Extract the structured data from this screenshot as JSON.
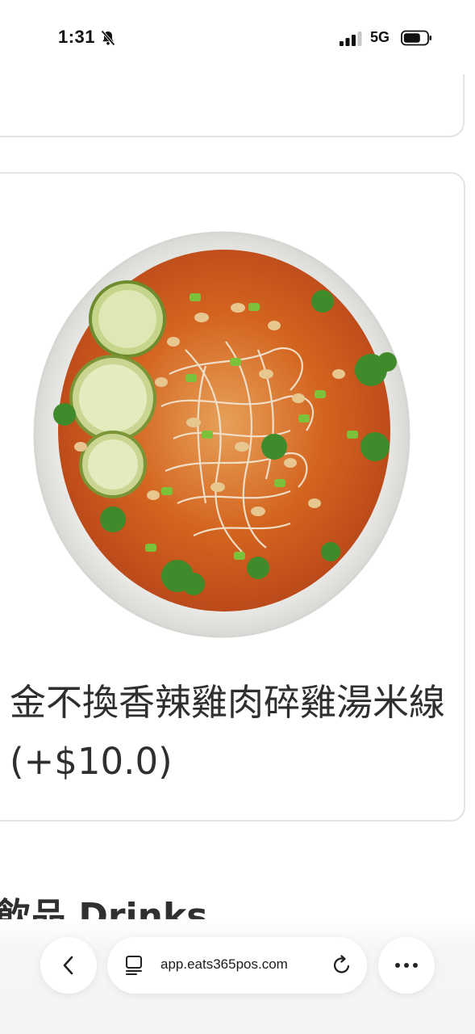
{
  "status_bar": {
    "time": "1:31",
    "network": "5G",
    "icons": [
      "bell-slash-icon",
      "cellular-signal-icon",
      "battery-icon"
    ]
  },
  "menu_item": {
    "name": "金不換香辣雞肉碎雞湯米線 (+$10.0)",
    "image": "spicy-chicken-rice-noodle-soup-photo"
  },
  "section": {
    "title": "飲品 Drinks"
  },
  "browser": {
    "url": "app.eats365pos.com",
    "icons": [
      "chevron-left-icon",
      "page-icon",
      "reload-icon",
      "more-icon"
    ]
  },
  "colors": {
    "card_border": "#e4e4e4",
    "text": "#2f2f2f",
    "toolbar_bg": "#f4f4f4"
  }
}
